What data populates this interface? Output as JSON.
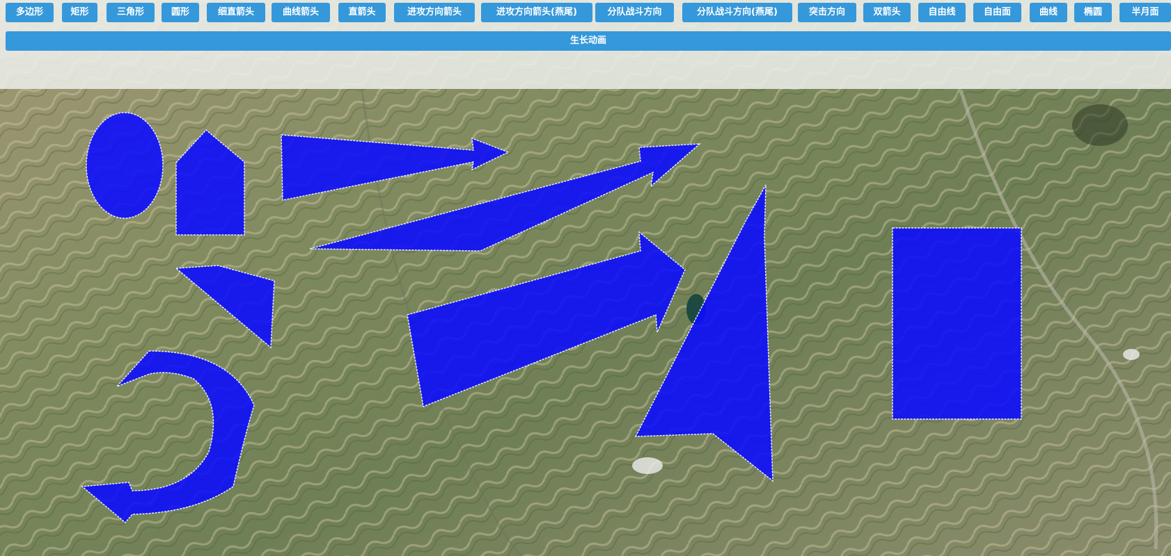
{
  "toolbar": {
    "buttons": [
      "多边形",
      "矩形",
      "三角形",
      "圆形",
      "细直箭头",
      "曲线箭头",
      "直箭头",
      "进攻方向箭头",
      "进攻方向箭头(燕尾)",
      "分队战斗方向",
      "分队战斗方向(燕尾)",
      "突击方向",
      "双箭头",
      "自由线",
      "自由面",
      "曲线",
      "椭圆",
      "半月面"
    ],
    "growth_animation": "生长动画"
  },
  "map": {
    "plot_color": "#0a0aff",
    "button_color": "#3598db"
  }
}
